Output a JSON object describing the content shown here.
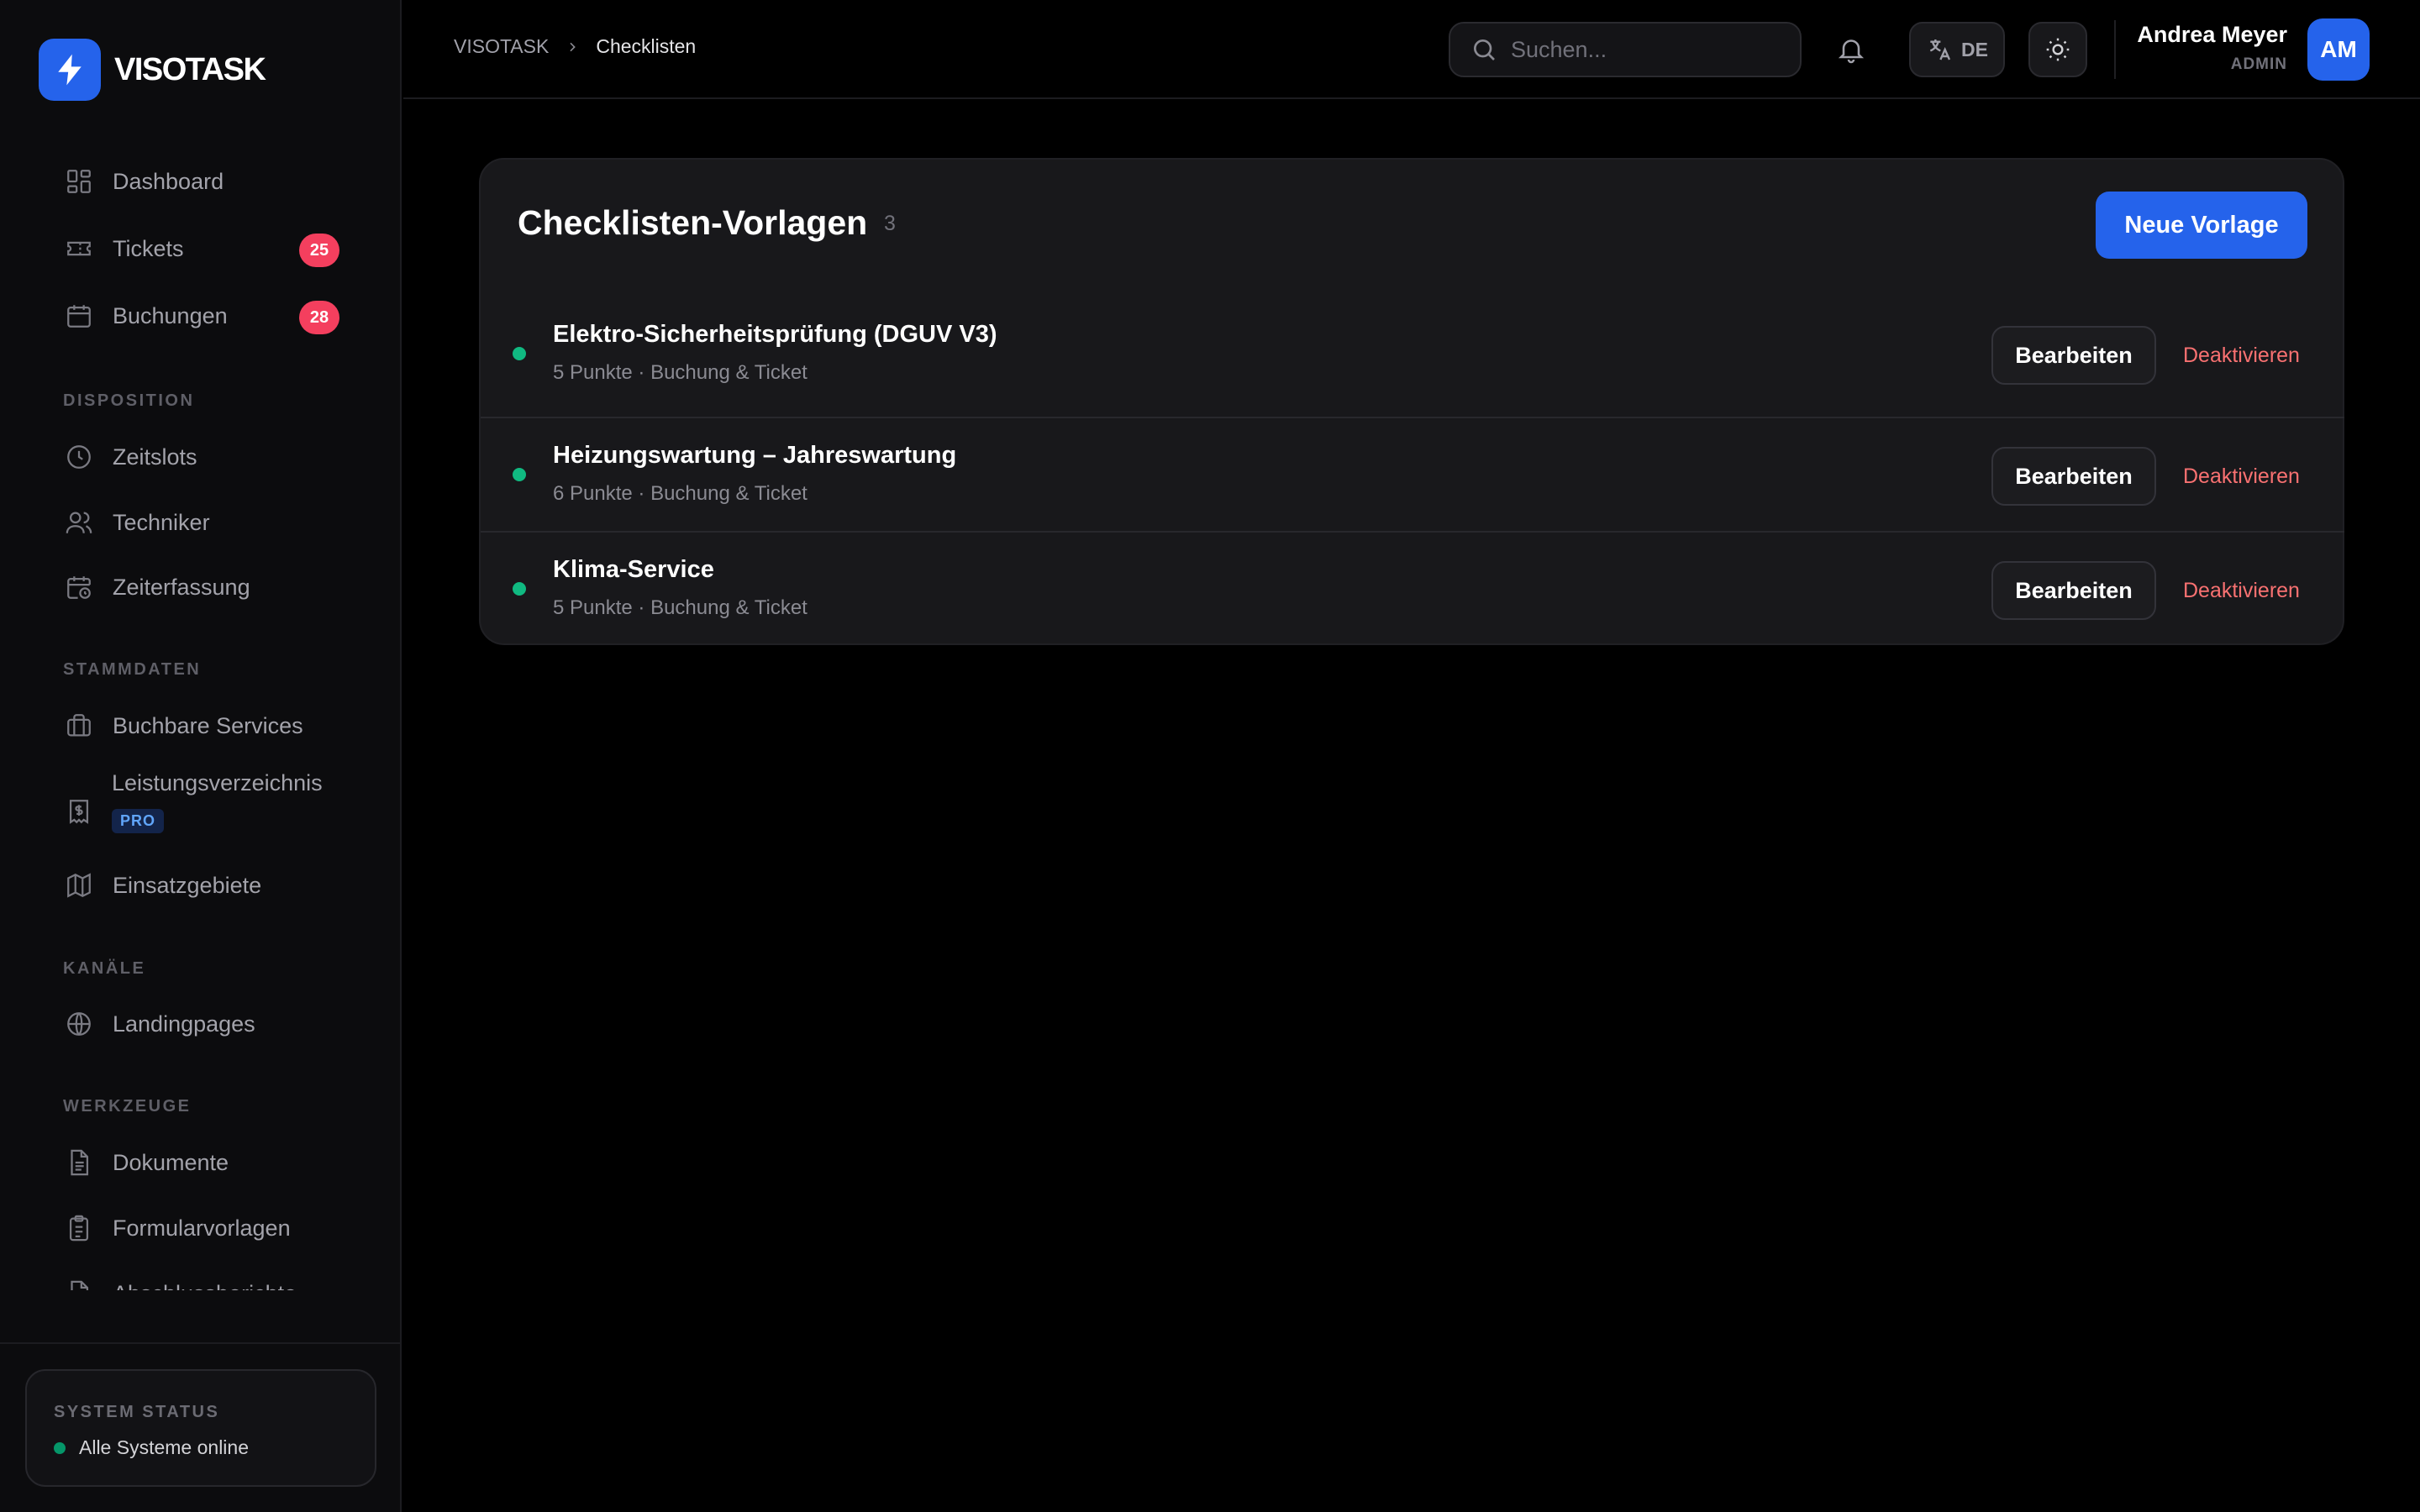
{
  "brand": {
    "name": "VISOTASK",
    "logo_icon": "bolt-icon",
    "accent": "#2563eb"
  },
  "sidebar": {
    "nav": [
      {
        "label": "Dashboard",
        "icon": "dashboard-grid-icon"
      },
      {
        "label": "Tickets",
        "icon": "ticket-icon",
        "badge": "25"
      },
      {
        "label": "Buchungen",
        "icon": "calendar-icon",
        "badge": "28"
      }
    ],
    "sections": [
      {
        "title": "DISPOSITION",
        "items": [
          {
            "label": "Zeitslots",
            "icon": "clock-icon"
          },
          {
            "label": "Techniker",
            "icon": "users-icon"
          },
          {
            "label": "Zeiterfassung",
            "icon": "calendar-clock-icon"
          }
        ]
      },
      {
        "title": "STAMMDATEN",
        "items": [
          {
            "label": "Buchbare Services",
            "icon": "briefcase-icon"
          },
          {
            "label": "Leistungsverzeichnis",
            "icon": "receipt-icon",
            "tag": "PRO"
          },
          {
            "label": "Einsatzgebiete",
            "icon": "map-icon"
          }
        ]
      },
      {
        "title": "KANÄLE",
        "items": [
          {
            "label": "Landingpages",
            "icon": "globe-icon"
          }
        ]
      },
      {
        "title": "WERKZEUGE",
        "items": [
          {
            "label": "Dokumente",
            "icon": "document-icon"
          },
          {
            "label": "Formularvorlagen",
            "icon": "clipboard-list-icon"
          },
          {
            "label": "Abschlussberichte",
            "icon": "report-icon"
          }
        ]
      }
    ],
    "status": {
      "title": "SYSTEM STATUS",
      "text": "Alle Systeme online",
      "color": "#059669"
    }
  },
  "topbar": {
    "breadcrumb": {
      "root": "VISOTASK",
      "current": "Checklisten"
    },
    "search": {
      "placeholder": "Suchen...",
      "value": ""
    },
    "language": "DE",
    "user": {
      "name": "Andrea Meyer",
      "role": "ADMIN",
      "initials": "AM"
    }
  },
  "main": {
    "title": "Checklisten-Vorlagen",
    "count": "3",
    "new_button": "Neue Vorlage",
    "templates": [
      {
        "name": "Elektro-Sicherheitsprüfung (DGUV V3)",
        "meta": "5 Punkte · Buchung & Ticket",
        "status_color": "#10b981"
      },
      {
        "name": "Heizungswartung – Jahreswartung",
        "meta": "6 Punkte · Buchung & Ticket",
        "status_color": "#10b981"
      },
      {
        "name": "Klima-Service",
        "meta": "5 Punkte · Buchung & Ticket",
        "status_color": "#10b981"
      }
    ],
    "edit_label": "Bearbeiten",
    "deactivate_label": "Deaktivieren",
    "deactivate_color": "#f87171"
  }
}
